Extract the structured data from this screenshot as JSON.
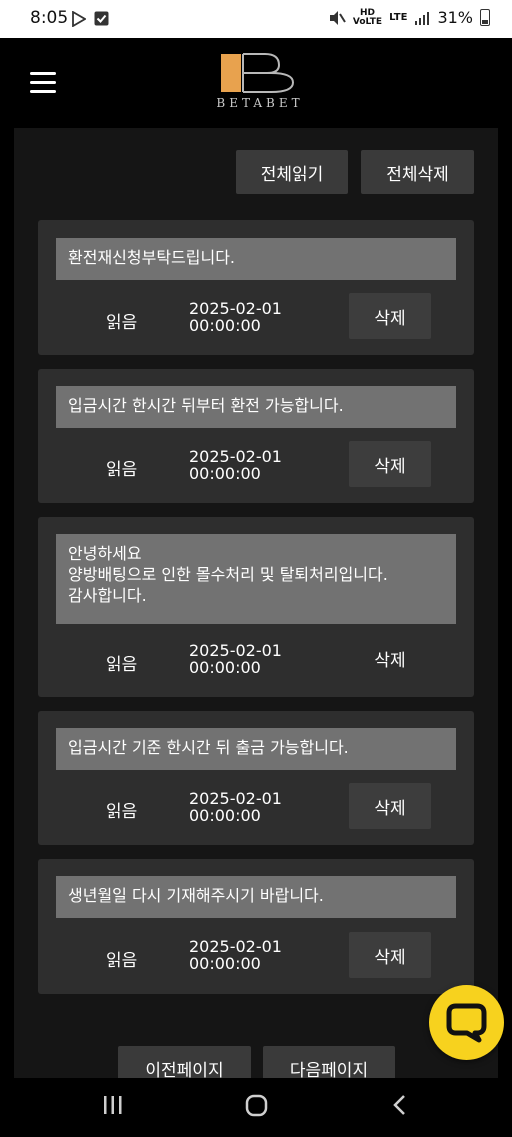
{
  "status_bar": {
    "time": "8:05",
    "battery": "31%",
    "icons": [
      "play-store-icon",
      "check-box-icon",
      "mute-icon",
      "hd-voice-icon",
      "lte-icon",
      "signal-icon",
      "battery-icon"
    ],
    "hd_label": "HD",
    "lte_label": "LTE"
  },
  "header": {
    "logo_text": "BETABET",
    "logo_colors": {
      "accent": "#e8a24e",
      "mark": "#b8b8b8"
    }
  },
  "actions": {
    "read_all": "전체읽기",
    "delete_all": "전체삭제"
  },
  "messages": [
    {
      "text": "환전재신청부탁드립니다.",
      "read_label": "읽음",
      "date": "2025-02-01",
      "time": "00:00:00",
      "delete_label": "삭제"
    },
    {
      "text": "입금시간 한시간 뒤부터 환전 가능합니다.",
      "read_label": "읽음",
      "date": "2025-02-01",
      "time": "00:00:00",
      "delete_label": "삭제"
    },
    {
      "text": "안녕하세요\n양방배팅으로 인한 몰수처리 및 탈퇴처리입니다.\n감사합니다.",
      "read_label": "읽음",
      "date": "2025-02-01",
      "time": "00:00:00",
      "delete_label": "삭제"
    },
    {
      "text": "입금시간 기준 한시간 뒤 출금 가능합니다.",
      "read_label": "읽음",
      "date": "2025-02-01",
      "time": "00:00:00",
      "delete_label": "삭제"
    },
    {
      "text": "생년월일 다시 기재해주시기 바랍니다.",
      "read_label": "읽음",
      "date": "2025-02-01",
      "time": "00:00:00",
      "delete_label": "삭제"
    }
  ],
  "pagination": {
    "prev": "이전페이지",
    "next": "다음페이지"
  },
  "chat_button": {
    "color": "#f7d21e",
    "icon": "chat-bubble-icon"
  },
  "nav_bar": {
    "icons": [
      "recent-apps-icon",
      "home-icon",
      "back-icon"
    ]
  }
}
